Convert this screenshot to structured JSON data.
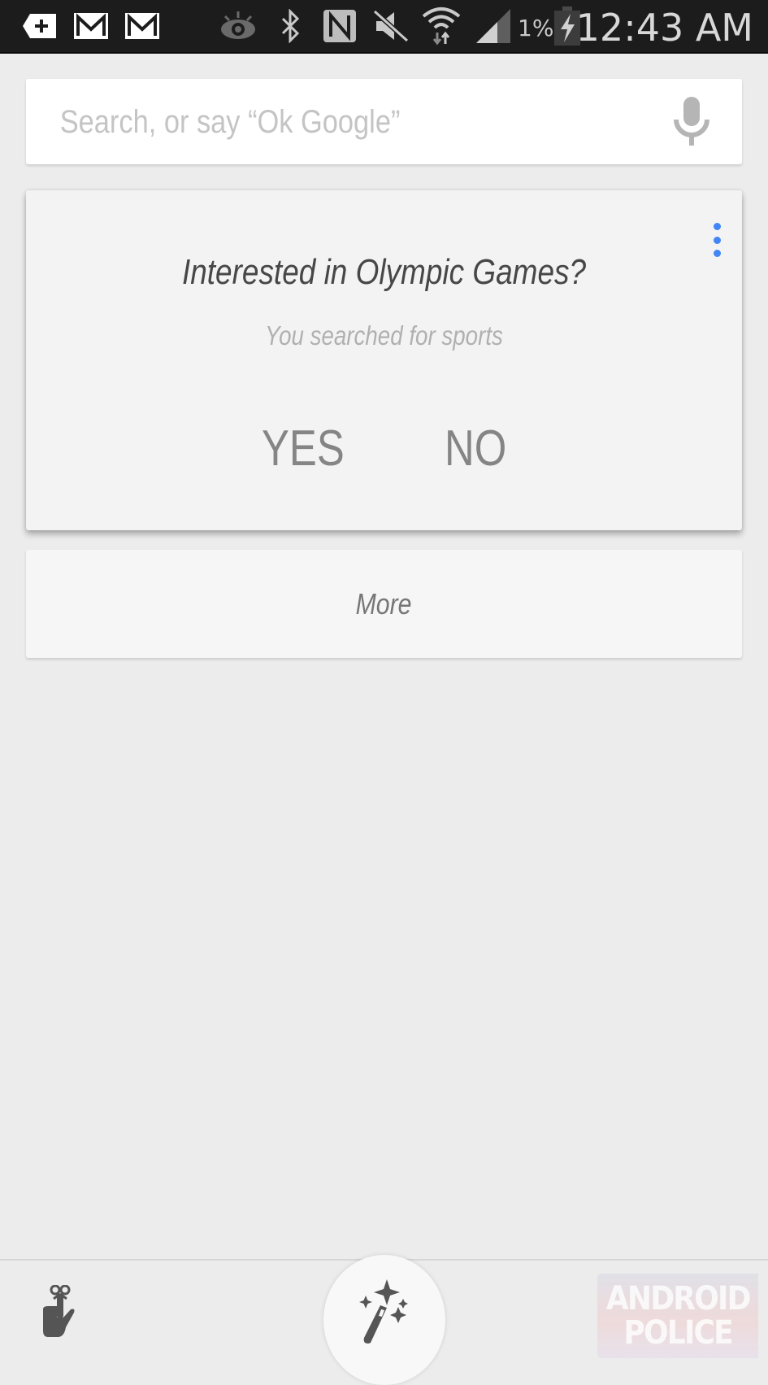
{
  "status_bar": {
    "notification_icons": [
      "add-notification-icon",
      "gmail-icon",
      "gmail-icon"
    ],
    "system_icons": [
      "smart-stay-eye-icon",
      "bluetooth-icon",
      "nfc-icon",
      "muted-icon",
      "wifi-icon",
      "signal-icon",
      "battery-charging-icon"
    ],
    "battery_percent": "1%",
    "time": "12:43 AM"
  },
  "search": {
    "placeholder": "Search, or say “Ok Google”",
    "value": "",
    "mic_icon": "microphone-icon"
  },
  "question_card": {
    "title": "Interested in Olympic Games?",
    "subtitle": "You searched for sports",
    "yes_label": "YES",
    "no_label": "NO",
    "menu_icon": "overflow-menu-icon",
    "accent_color": "#4285f4"
  },
  "more_card": {
    "label": "More"
  },
  "bottom_bar": {
    "left_icon": "reminder-icon",
    "center_icon": "magic-wand-icon"
  },
  "watermark": {
    "line1": "ANDROID",
    "line2": "POLICE"
  }
}
